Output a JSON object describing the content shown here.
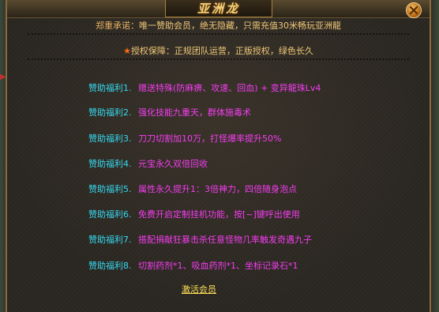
{
  "window": {
    "title": "亚洲龙"
  },
  "header": {
    "line1_prefix": "郑重承诺：",
    "line1_main": "唯一赞助会员，绝无隐藏，只需充值30米畅玩亚洲龍",
    "star": "★",
    "line2": "授权保障：正规团队运营，正版授权，绿色长久"
  },
  "benefits": [
    {
      "label": "赞助福利1.",
      "text": "赠送特殊(防麻痹、攻速、回血) + 变异龍珠Lv4"
    },
    {
      "label": "赞助福利2.",
      "text": "强化技能九重天，群体施毒术"
    },
    {
      "label": "赞助福利3.",
      "text": "刀刀切割加10万，打怪爆率提升50%"
    },
    {
      "label": "赞助福利4.",
      "text": "元宝永久双倍回收"
    },
    {
      "label": "赞助福利5.",
      "text": "属性永久提升1：3倍神力，四倍随身泡点"
    },
    {
      "label": "赞助福利6.",
      "text": "免费开启定制挂机功能，按[~]键呼出使用"
    },
    {
      "label": "赞助福利7.",
      "text": "搭配捐献狂暴击杀任意怪物几率触发奇遇九子"
    },
    {
      "label": "赞助福利8.",
      "text": "切割药剂*1、吸血药剂*1、坐标记录石*1"
    }
  ],
  "activate_label": "激活会员",
  "colors": {
    "label": "#36d8f0",
    "text": "#f53cf0",
    "gold": "#f0c878",
    "link": "#ffe15a"
  }
}
